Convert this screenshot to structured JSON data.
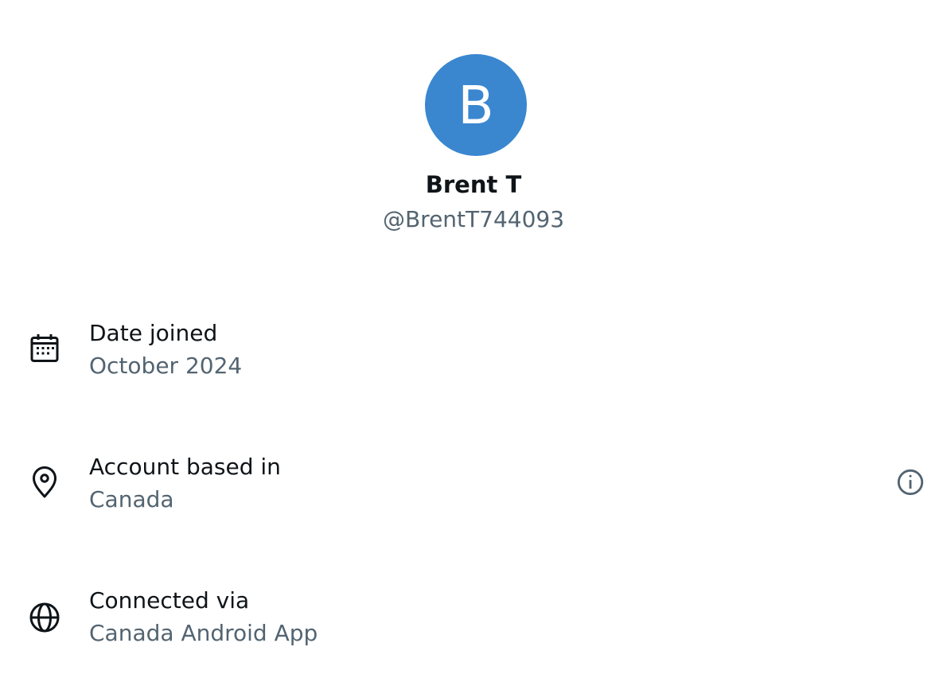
{
  "profile": {
    "avatar_initial": "B",
    "avatar_color": "#3a87d0",
    "display_name": "Brent T",
    "handle": "@BrentT744093"
  },
  "rows": [
    {
      "icon": "calendar-icon",
      "label": "Date joined",
      "value": "October 2024"
    },
    {
      "icon": "location-pin-icon",
      "label": "Account based in",
      "value": "Canada",
      "trailing_icon": "info-icon"
    },
    {
      "icon": "globe-icon",
      "label": "Connected via",
      "value": "Canada Android App"
    }
  ],
  "colors": {
    "primary_text": "#0f1419",
    "secondary_text": "#536471",
    "background": "#ffffff"
  }
}
